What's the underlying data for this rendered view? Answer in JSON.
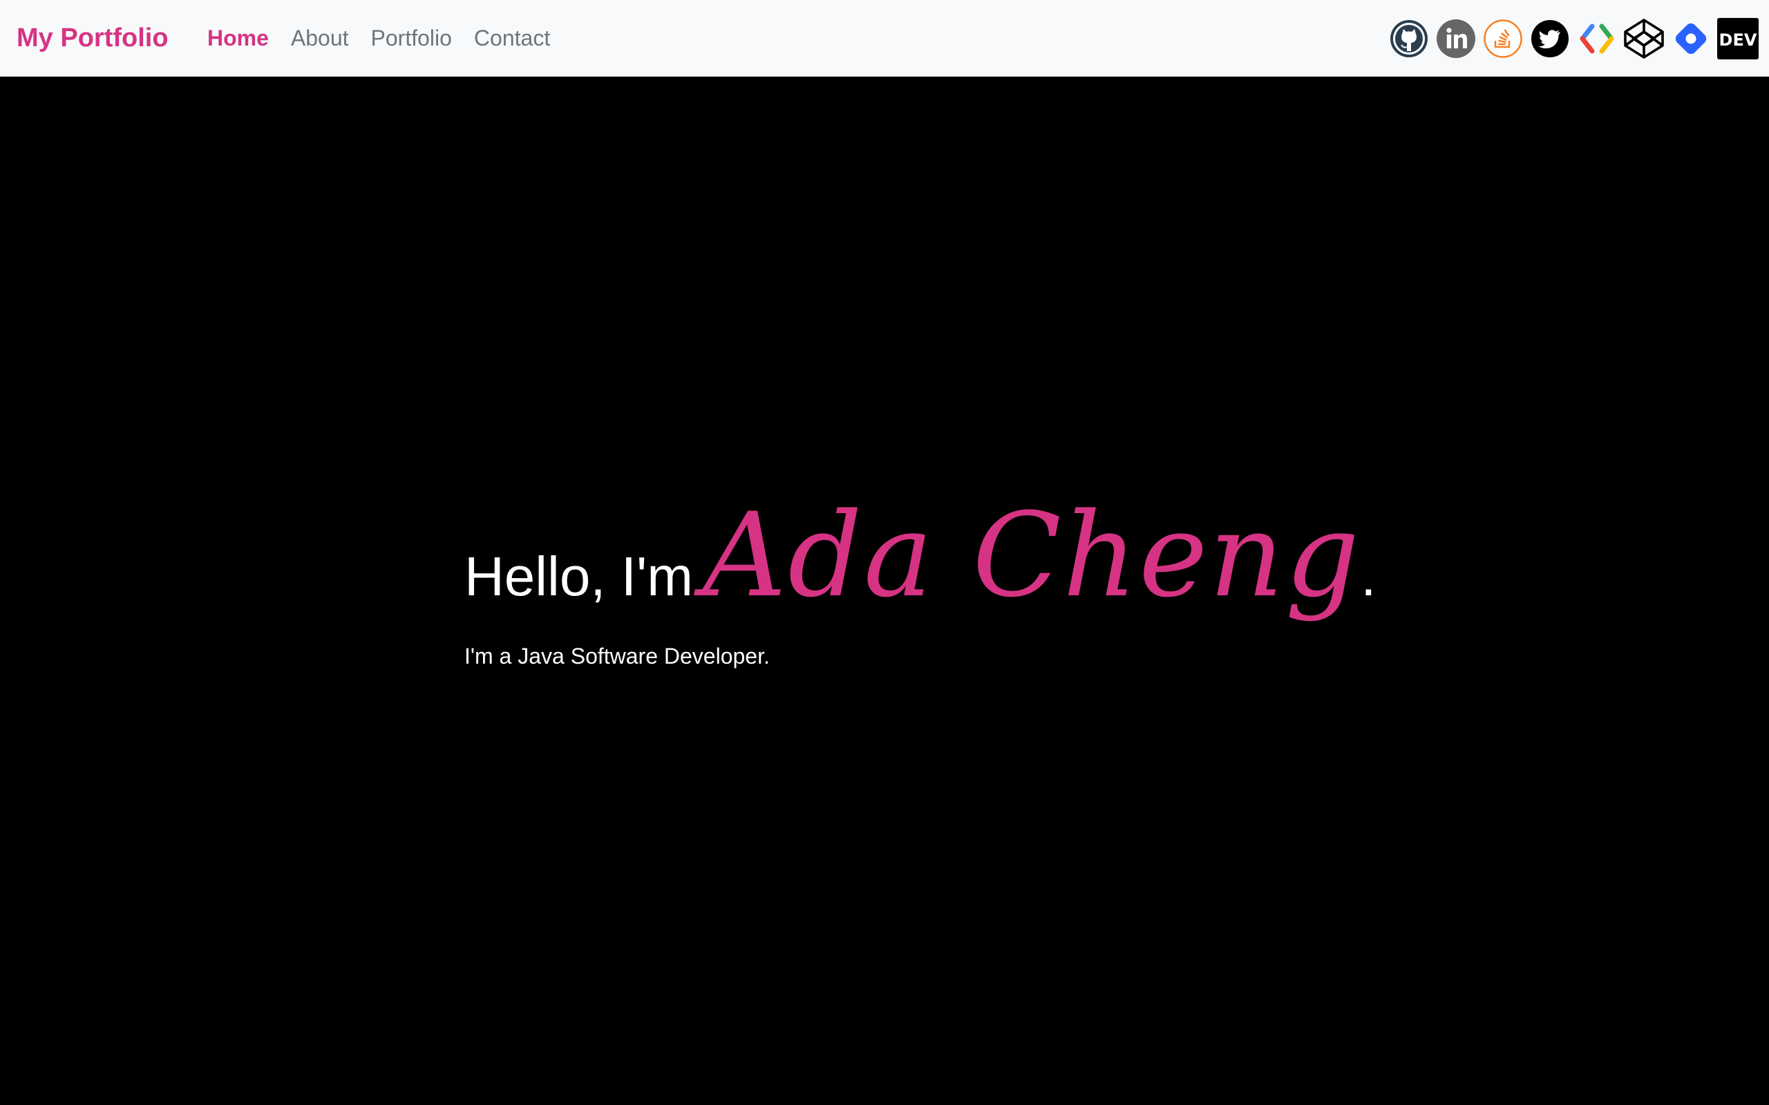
{
  "nav": {
    "brand": "My Portfolio",
    "links": [
      {
        "label": "Home",
        "active": true
      },
      {
        "label": "About",
        "active": false
      },
      {
        "label": "Portfolio",
        "active": false
      },
      {
        "label": "Contact",
        "active": false
      }
    ],
    "social": [
      {
        "icon": "github-icon"
      },
      {
        "icon": "linkedin-icon"
      },
      {
        "icon": "stackoverflow-icon"
      },
      {
        "icon": "twitter-icon"
      },
      {
        "icon": "google-developers-icon"
      },
      {
        "icon": "codepen-icon"
      },
      {
        "icon": "jsfiddle-icon"
      },
      {
        "icon": "dev-icon",
        "text": "DEV"
      }
    ]
  },
  "hero": {
    "greeting": "Hello, I'm",
    "name": "Ada Cheng",
    "punct": ".",
    "subtitle": "I'm a Java Software Developer."
  },
  "colors": {
    "accent": "#d63384",
    "navbar_bg": "#f8f9fa",
    "hero_bg": "#000000",
    "nav_link": "#6c757d"
  }
}
